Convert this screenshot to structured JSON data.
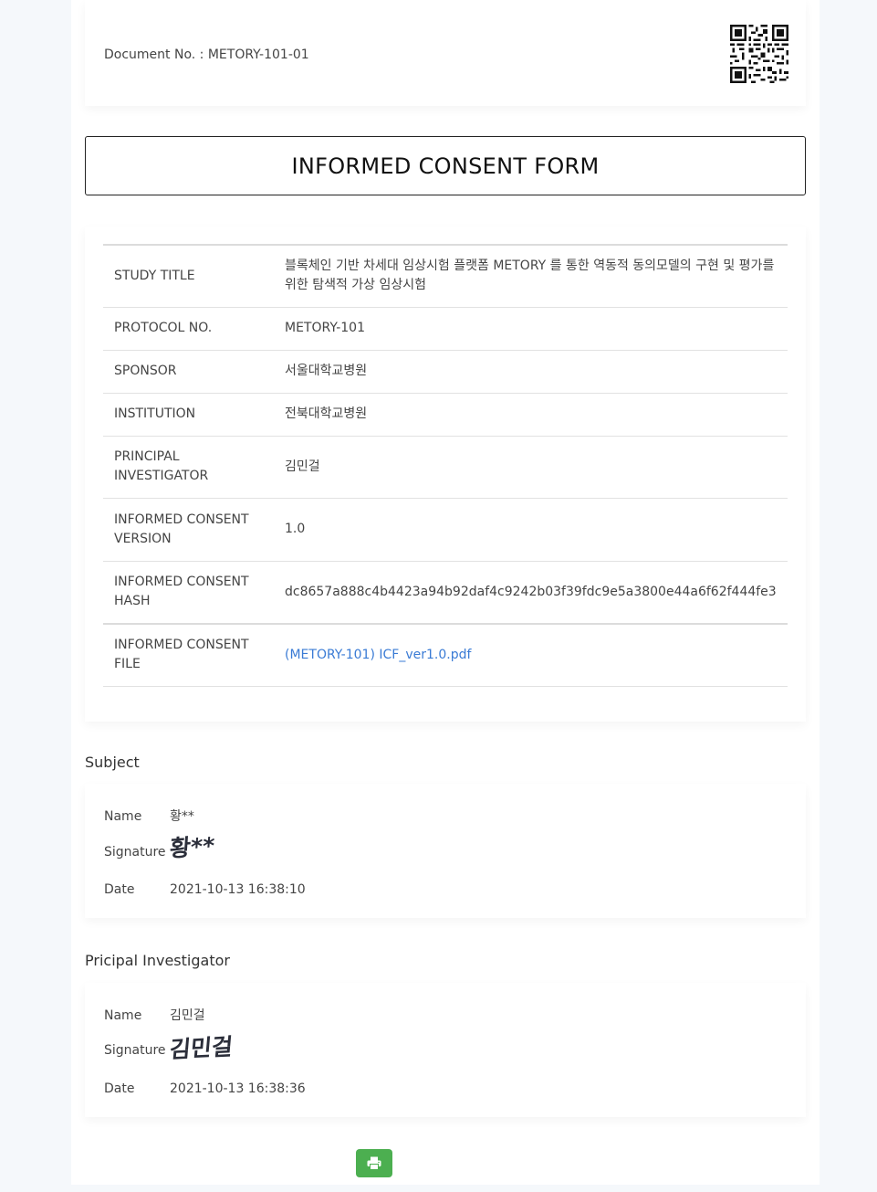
{
  "header": {
    "document_no": "Document No. : METORY-101-01",
    "qr_icon": "qr-code"
  },
  "form_title": "INFORMED CONSENT FORM",
  "study_info": [
    {
      "label": "STUDY TITLE",
      "value": "블록체인 기반 차세대 임상시험 플랫폼 METORY 를 통한 역동적 동의모델의 구현 및 평가를 위한 탐색적 가상 임상시험"
    },
    {
      "label": "PROTOCOL NO.",
      "value": "METORY-101"
    },
    {
      "label": "SPONSOR",
      "value": "서울대학교병원"
    },
    {
      "label": "INSTITUTION",
      "value": "전북대학교병원"
    },
    {
      "label": "PRINCIPAL INVESTIGATOR",
      "value": "김민걸"
    },
    {
      "label": "INFORMED CONSENT VERSION",
      "value": "1.0"
    },
    {
      "label": "INFORMED CONSENT HASH",
      "value": "dc8657a888c4b4423a94b92daf4c9242b03f39fdc9e5a3800e44a6f62f444fe3"
    },
    {
      "label": "INFORMED CONSENT FILE",
      "value": "(METORY-101) ICF_ver1.0.pdf"
    }
  ],
  "subject": {
    "section_title": "Subject",
    "name_label": "Name",
    "name": "황**",
    "signature_label": "Signature",
    "signature_text": "황**",
    "date_label": "Date",
    "date": "2021-10-13 16:38:10"
  },
  "investigator": {
    "section_title": "Pricipal Investigator",
    "name_label": "Name",
    "name": "김민걸",
    "signature_label": "Signature",
    "signature_text": "김민걸",
    "date_label": "Date",
    "date": "2021-10-13 16:38:36"
  },
  "print_button": {
    "icon": "print-icon",
    "color": "#4caf50"
  },
  "link_color": "#3a7bd5"
}
